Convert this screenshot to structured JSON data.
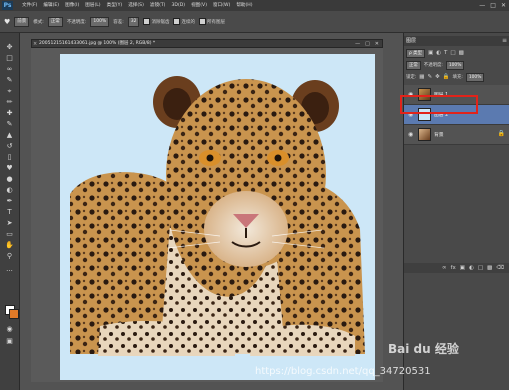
{
  "app": {
    "logo": "Ps"
  },
  "menu": [
    "文件(F)",
    "编辑(E)",
    "图像(I)",
    "图层(L)",
    "类型(Y)",
    "选择(S)",
    "滤镜(T)",
    "3D(D)",
    "视图(V)",
    "窗口(W)",
    "帮助(H)"
  ],
  "window_controls": [
    "—",
    "□",
    "✕"
  ],
  "options": {
    "tool_icon": "paint-bucket-icon",
    "fill_source": "前景",
    "mode_label": "模式:",
    "mode_value": "正常",
    "opacity_label": "不透明度:",
    "opacity_value": "100%",
    "tolerance_label": "容差:",
    "tolerance_value": "32",
    "antialias": "消除锯齿",
    "contiguous": "连续的",
    "all_layers": "所有图层"
  },
  "document": {
    "tab_title": "20051215161433061.jpg @ 100% (图层 2, RGB/8) *",
    "close_glyph": "×",
    "controls": [
      "—",
      "□",
      "✕"
    ]
  },
  "layers_panel": {
    "tab_label": "图层",
    "menu_glyph": "≡",
    "filter_kind": "ρ 类型",
    "blend_mode": "正常",
    "opacity_label": "不透明度:",
    "opacity_value": "100%",
    "lock_label": "锁定:",
    "fill_label": "填充:",
    "fill_value": "100%",
    "layers": [
      {
        "name": "图层 1",
        "selected": false,
        "locked": false
      },
      {
        "name": "图层 2",
        "selected": true,
        "locked": false
      },
      {
        "name": "背景",
        "selected": false,
        "locked": true
      }
    ],
    "footer_icons": [
      "link-icon",
      "fx-icon",
      "mask-icon",
      "adjustment-icon",
      "group-icon",
      "new-layer-icon",
      "trash-icon"
    ]
  },
  "watermark": {
    "brand": "Bai du 经验",
    "url": "https://blog.csdn.net/qq_34720531"
  },
  "colors": {
    "canvas_fill": "#cde7f7",
    "selected_layer": "#5b7ab0",
    "highlight_box": "#e2231a",
    "background_color_swatch": "#e07a28"
  }
}
